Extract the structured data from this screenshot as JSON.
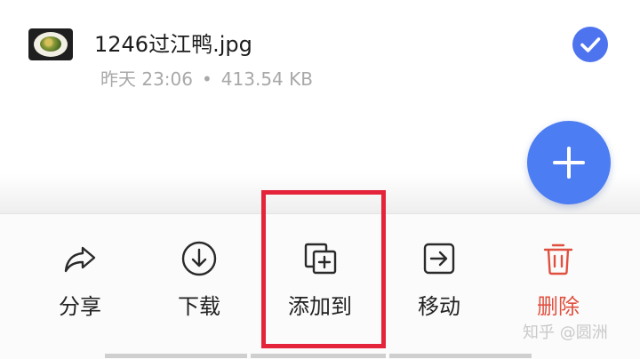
{
  "file": {
    "name": "1246过江鸭.jpg",
    "date": "昨天 23:06",
    "separator": "•",
    "size": "413.54 KB",
    "selected": true,
    "thumbnail": "dish-photo"
  },
  "fab": {
    "icon": "plus-icon"
  },
  "actions": [
    {
      "label": "分享",
      "icon": "share-icon"
    },
    {
      "label": "下载",
      "icon": "download-icon"
    },
    {
      "label": "添加到",
      "icon": "add-to-icon"
    },
    {
      "label": "移动",
      "icon": "move-icon"
    },
    {
      "label": "删除",
      "icon": "trash-icon"
    }
  ],
  "watermark": "知乎 @圆洲",
  "colors": {
    "accent": "#4d74ee",
    "danger": "#e0503f",
    "highlight": "#e4243a",
    "meta_text": "#a8a8a8"
  }
}
